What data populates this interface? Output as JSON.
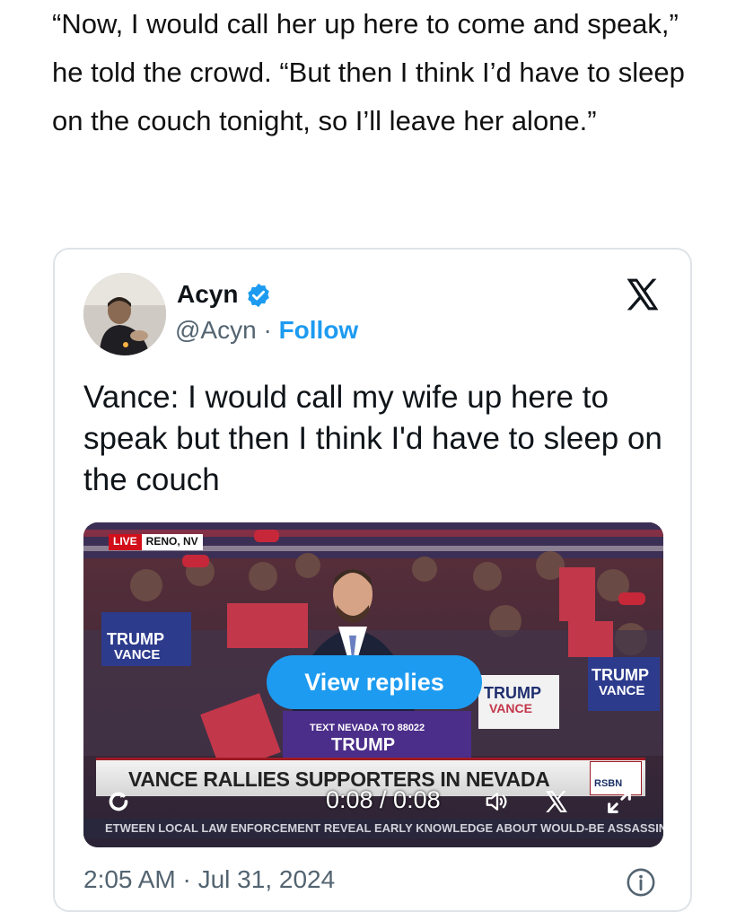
{
  "article": {
    "paragraph": "“Now, I would call her up here to come and speak,” he told the crowd. “But then I think I’d have to sleep on the couch tonight, so I’ll leave her alone.”"
  },
  "tweet": {
    "author_name": "Acyn",
    "handle": "@Acyn",
    "separator": " · ",
    "follow_label": "Follow",
    "text": "Vance: I would call my wife up here to speak but then I think I'd have to sleep on the couch",
    "timestamp": "2:05 AM · Jul 31, 2024"
  },
  "video": {
    "live_label": "LIVE",
    "location": "RENO, NV",
    "view_replies_label": "View replies",
    "banner_title": "VANCE RALLIES SUPPORTERS IN NEVADA",
    "network": "RSBN",
    "ticker": "ETWEEN LOCAL LAW ENFORCEMENT REVEAL EARLY KNOWLEDGE ABOUT WOULD-BE ASSASSIN",
    "podium_small": "TEXT NEVADA TO 88022",
    "podium_big": "TRUMP",
    "time": "0:08 / 0:08",
    "progress_fraction": 1.0
  },
  "colors": {
    "accent": "#1d9bf0",
    "text": "#0f1419",
    "muted": "#536471"
  },
  "icons": [
    "verified-badge-icon",
    "x-logo-icon",
    "replay-icon",
    "volume-icon",
    "x-icon",
    "expand-icon",
    "info-icon"
  ]
}
